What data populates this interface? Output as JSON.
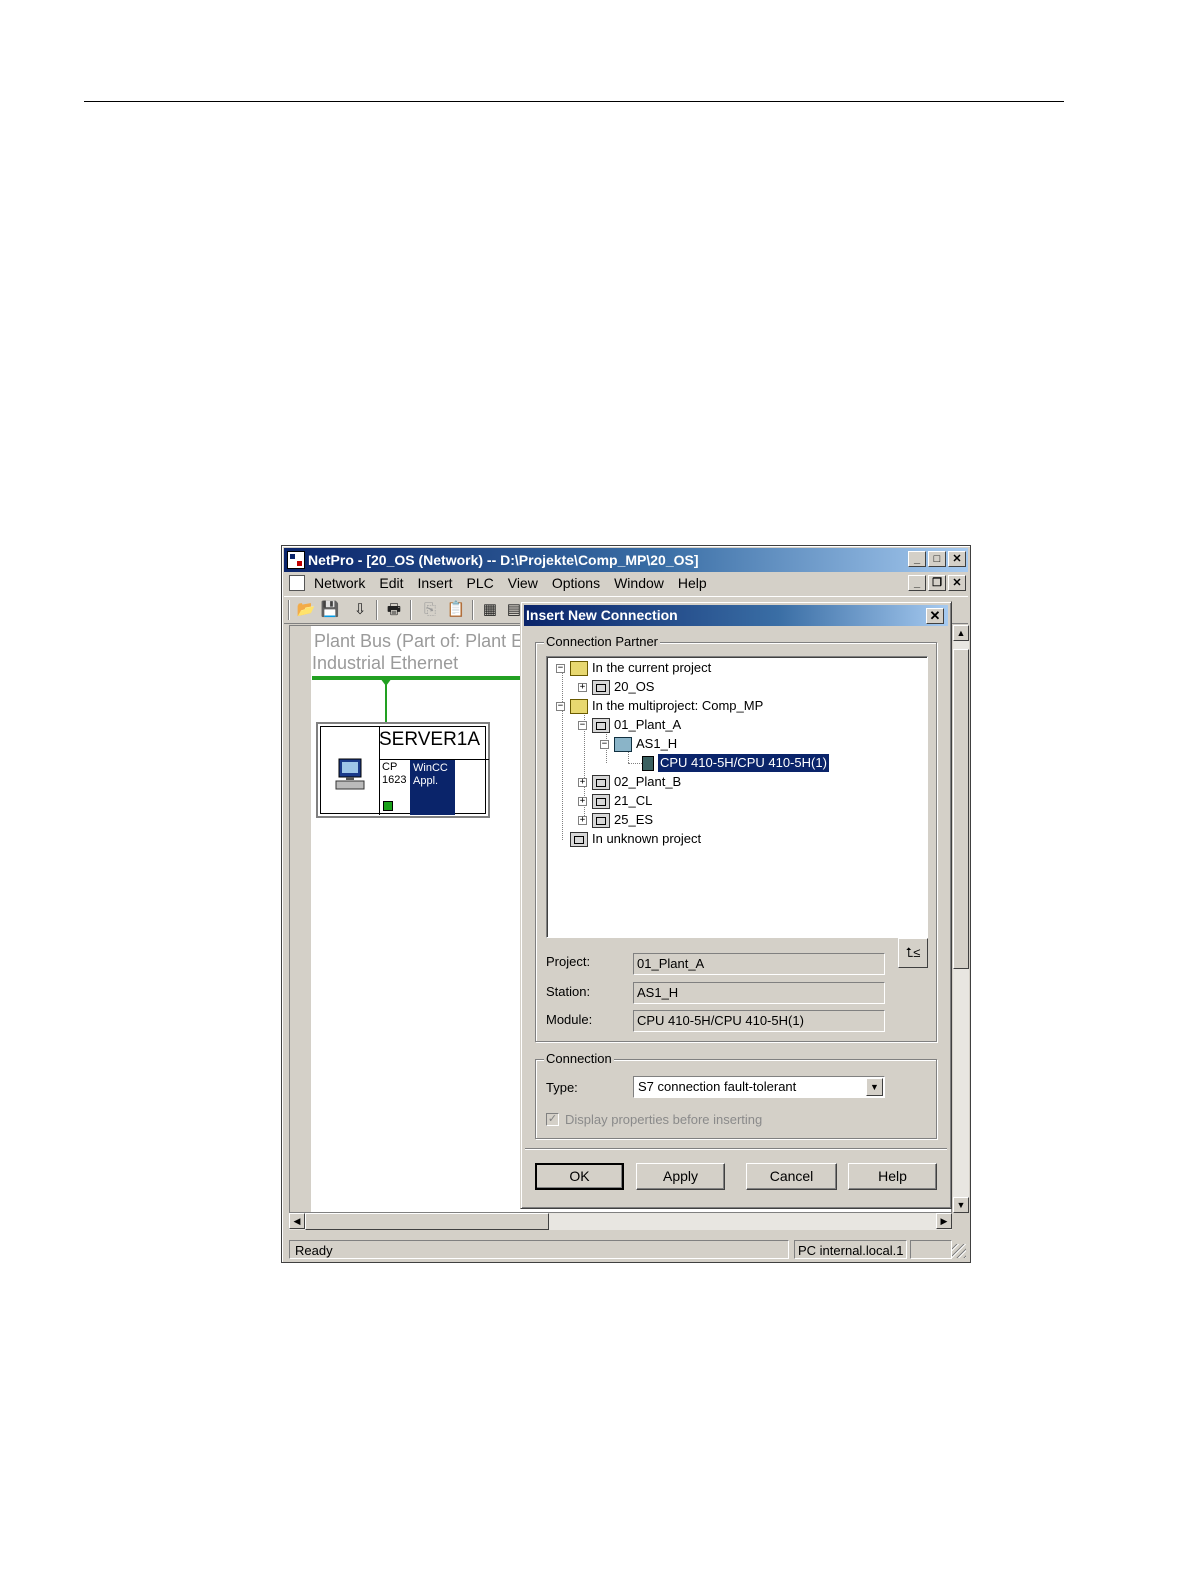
{
  "app": {
    "title": "NetPro - [20_OS (Network) -- D:\\Projekte\\Comp_MP\\20_OS]",
    "menu": [
      "Network",
      "Edit",
      "Insert",
      "PLC",
      "View",
      "Options",
      "Window",
      "Help"
    ],
    "caption_buttons": {
      "minimize": "_",
      "maximize": "□",
      "restore": "❐",
      "close": "✕"
    }
  },
  "toolbar": {
    "icons": [
      "open-icon",
      "save-icon",
      "download-icon",
      "print-icon",
      "copy-icon",
      "paste-icon",
      "configure-icon",
      "configure-network-icon"
    ]
  },
  "network": {
    "subnet_name": "Plant Bus (Part of: Plant E",
    "subnet_type": "Industrial Ethernet",
    "station": {
      "name": "SERVER1A",
      "cp_label": "CP\n1623",
      "application_label": "WinCC\nAppl.",
      "bus_color": "#22a022"
    }
  },
  "status": {
    "left": "Ready",
    "interface": "PC internal.local.1"
  },
  "dialog": {
    "title": "Insert New Connection",
    "close": "✕",
    "partner_group": "Connection Partner",
    "tree": [
      {
        "label": "In the current project",
        "expander": "−",
        "icon": "folder-icon"
      },
      {
        "label": "20_OS",
        "expander": "+",
        "icon": "project-icon"
      },
      {
        "label": "In the multiproject: Comp_MP",
        "expander": "−",
        "icon": "multiproject-icon"
      },
      {
        "label": "01_Plant_A",
        "expander": "−",
        "icon": "project-icon"
      },
      {
        "label": "AS1_H",
        "expander": "−",
        "icon": "station-icon"
      },
      {
        "label": "CPU 410-5H/CPU 410-5H(1)",
        "expander": "",
        "icon": "cpu-icon",
        "selected": true
      },
      {
        "label": "02_Plant_B",
        "expander": "+",
        "icon": "project-icon"
      },
      {
        "label": "21_CL",
        "expander": "+",
        "icon": "project-icon"
      },
      {
        "label": "25_ES",
        "expander": "+",
        "icon": "project-icon"
      },
      {
        "label": "In unknown project",
        "expander": "",
        "icon": "project-icon"
      }
    ],
    "toggle_view_label": "⮤≤",
    "fields": {
      "project_label": "Project:",
      "project_value": "01_Plant_A",
      "station_label": "Station:",
      "station_value": "AS1_H",
      "module_label": "Module:",
      "module_value": "CPU 410-5H/CPU 410-5H(1)"
    },
    "connection_group": "Connection",
    "type_label": "Type:",
    "type_value": "S7 connection fault-tolerant",
    "display_props_label": "Display properties before inserting",
    "display_props_checked": true,
    "buttons": {
      "ok": "OK",
      "apply": "Apply",
      "cancel": "Cancel",
      "help": "Help"
    }
  }
}
